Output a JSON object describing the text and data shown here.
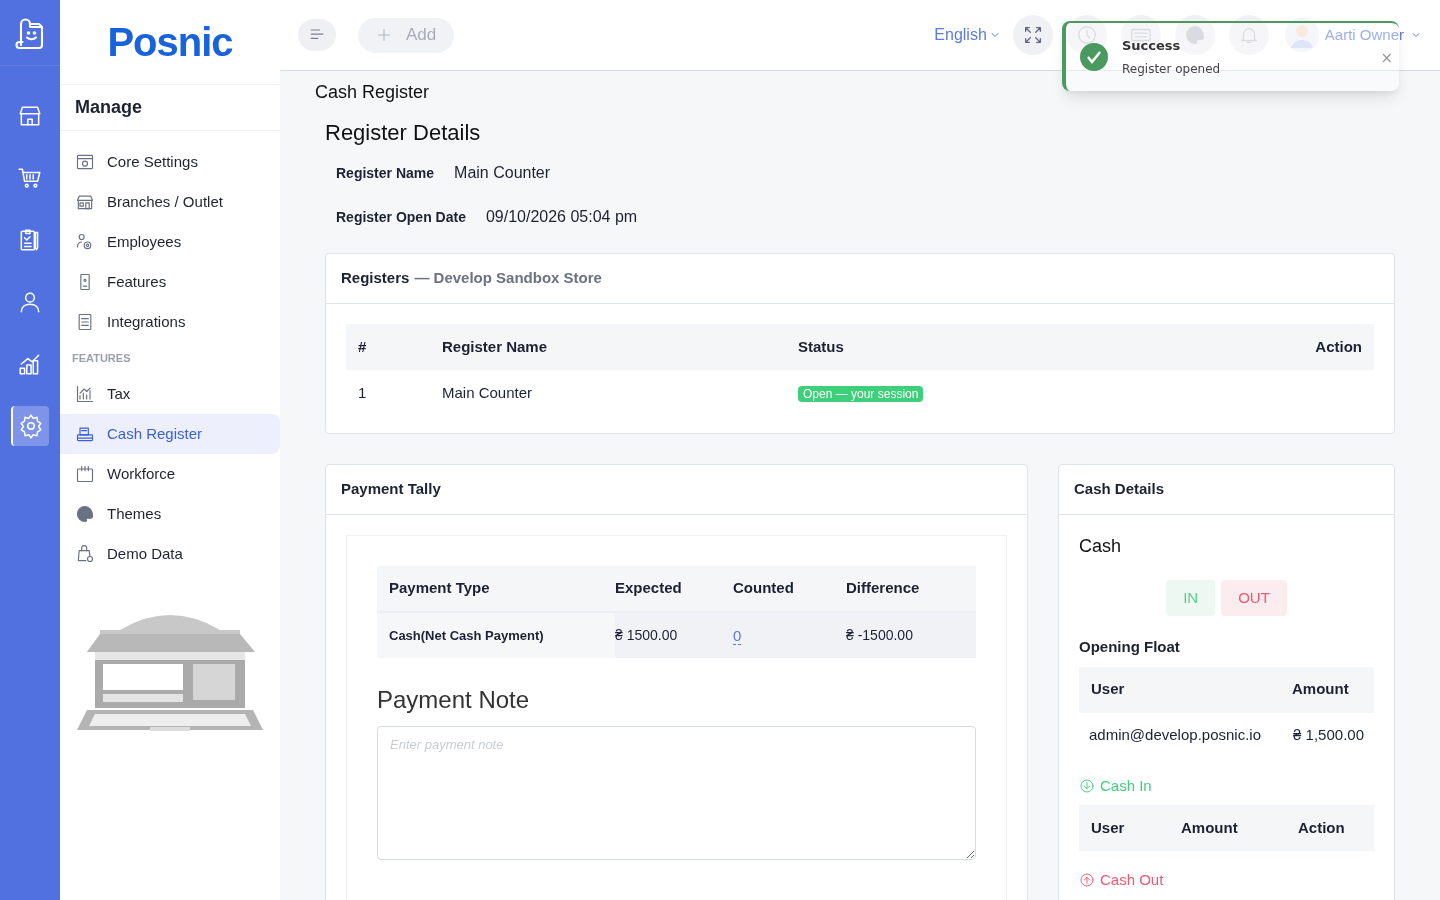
{
  "rail": {
    "items": [
      {
        "selected": false
      },
      {
        "selected": false
      },
      {
        "selected": false
      },
      {
        "selected": false
      },
      {
        "selected": false
      },
      {
        "selected": true
      }
    ]
  },
  "sidebar": {
    "brand": "Posnic",
    "heading": "Manage",
    "groups": [
      {
        "items": [
          {
            "label": "Core Settings",
            "selected": false
          },
          {
            "label": "Branches / Outlet",
            "selected": false
          },
          {
            "label": "Employees",
            "selected": false
          },
          {
            "label": "Features",
            "selected": false
          },
          {
            "label": "Integrations",
            "selected": false
          }
        ]
      },
      {
        "title": "FEATURES",
        "items": [
          {
            "label": "Tax",
            "selected": false
          },
          {
            "label": "Cash Register",
            "selected": true
          },
          {
            "label": "Workforce",
            "selected": false
          },
          {
            "label": "Themes",
            "selected": false
          },
          {
            "label": "Demo Data",
            "selected": false
          }
        ]
      }
    ]
  },
  "header": {
    "add": "Add",
    "language": "English",
    "user": "Aarti Owner"
  },
  "toast": {
    "title": "Success",
    "message": "Register opened",
    "close": "×"
  },
  "breadcrumb": "Cash Register",
  "title": "Register Details",
  "details": [
    {
      "label": "Register Name",
      "value": "Main Counter"
    },
    {
      "label": "Register Open Date",
      "value": "09/10/2026 05:04 pm"
    }
  ],
  "registers": {
    "title": "Registers",
    "store": "— Develop Sandbox Store",
    "columns": [
      "#",
      "Register Name",
      "Status",
      "Action"
    ],
    "rows": [
      {
        "cells": [
          "1",
          "Main Counter"
        ],
        "status": "Open — your session",
        "color": "#3ecf7a"
      }
    ]
  },
  "tally": {
    "title": "Payment Tally",
    "columns": [
      "Payment Type",
      "Expected",
      "Counted",
      "Difference"
    ],
    "rows": [
      {
        "type": "Cash(Net Cash Payment)",
        "expected": "₴ 1500.00",
        "counted": "0",
        "difference": "₴ -1500.00"
      }
    ],
    "note_title": "Payment Note",
    "note_placeholder": "Enter payment note"
  },
  "cash": {
    "title": "Cash Details",
    "heading": "Cash",
    "in": "IN",
    "out": "OUT",
    "float_title": "Opening Float",
    "float_columns": [
      "User",
      "Amount"
    ],
    "float_rows": [
      [
        "admin@develop.posnic.io",
        "₴ 1,500.00"
      ]
    ],
    "cash_in": "Cash In",
    "cash_in_columns": [
      "User",
      "Amount",
      "Action"
    ],
    "cash_out": "Cash Out"
  }
}
